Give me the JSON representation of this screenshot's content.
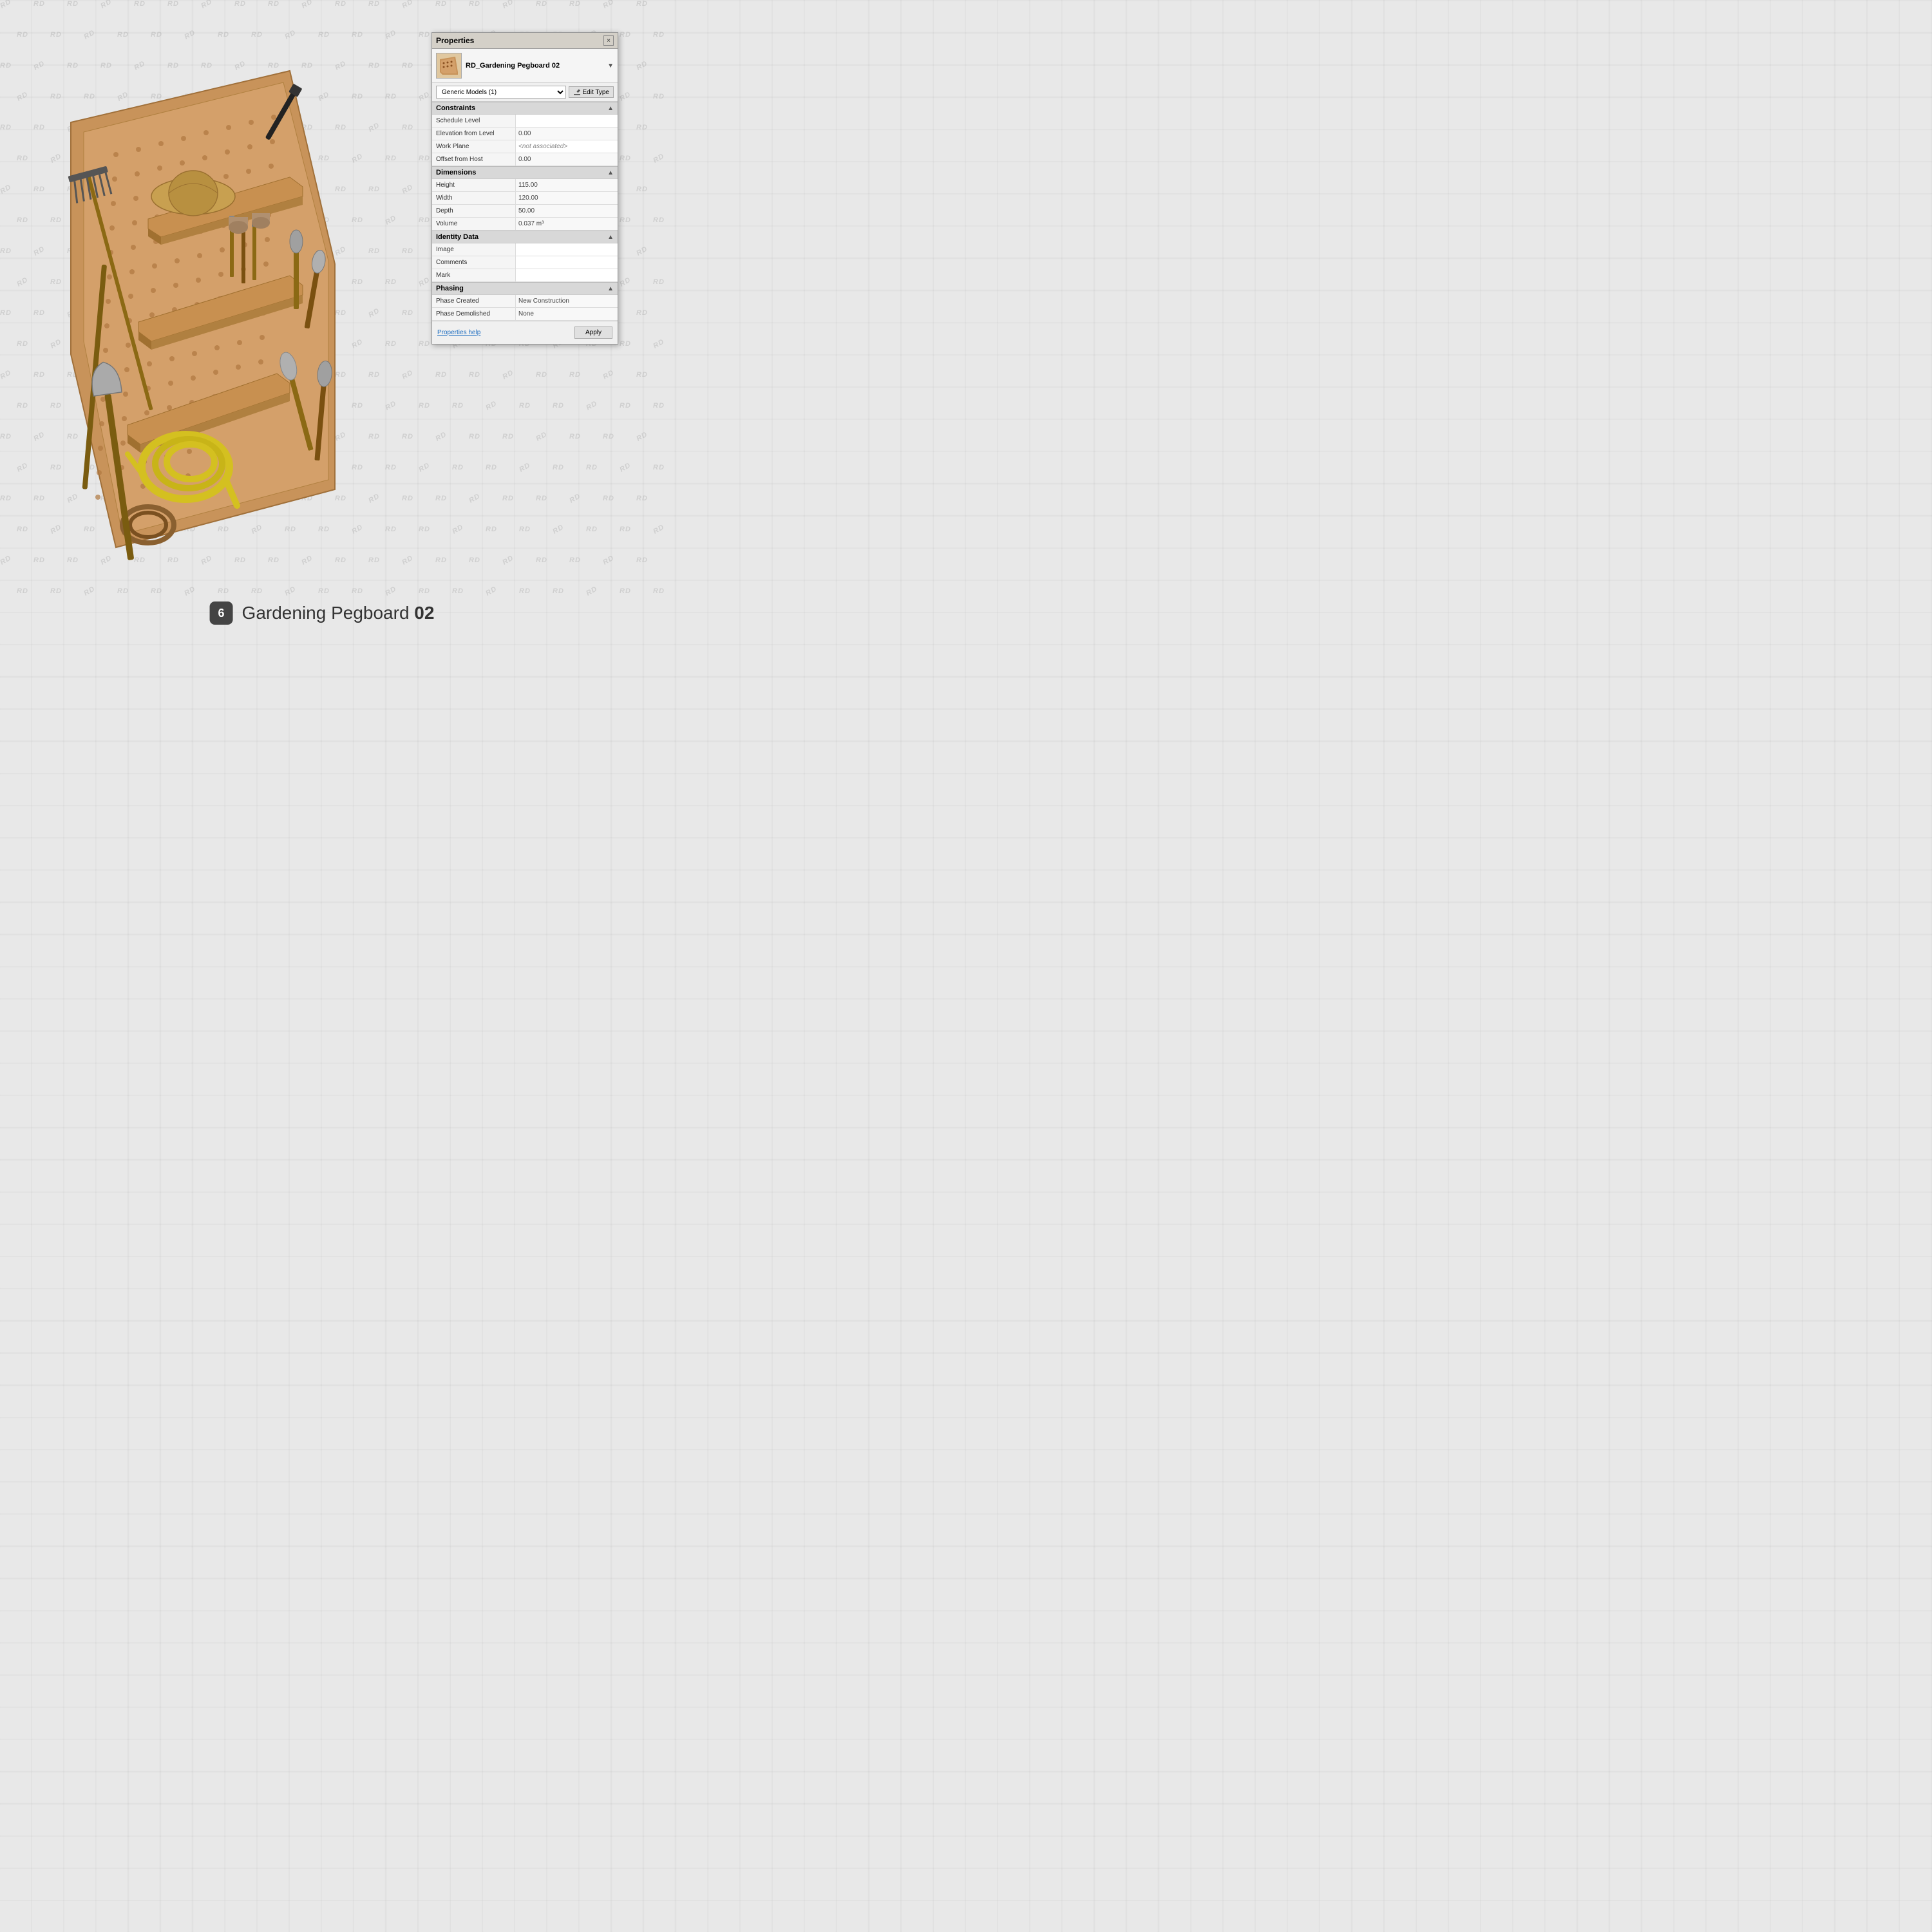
{
  "panel": {
    "title": "Properties",
    "close_label": "×",
    "type_name": "RD_Gardening Pegboard 02",
    "dropdown_value": "Generic Models (1)",
    "edit_type_label": "Edit Type",
    "sections": {
      "constraints": {
        "title": "Constraints",
        "collapse_icon": "▲",
        "rows": [
          {
            "label": "Schedule Level",
            "value": "",
            "type": "editable"
          },
          {
            "label": "Elevation from Level",
            "value": "0.00",
            "type": "readonly"
          },
          {
            "label": "Work Plane",
            "value": "<not associated>",
            "type": "italic-gray"
          },
          {
            "label": "Offset from Host",
            "value": "0.00",
            "type": "readonly"
          }
        ]
      },
      "dimensions": {
        "title": "Dimensions",
        "collapse_icon": "▲",
        "rows": [
          {
            "label": "Height",
            "value": "115.00",
            "type": "readonly"
          },
          {
            "label": "Width",
            "value": "120.00",
            "type": "readonly"
          },
          {
            "label": "Depth",
            "value": "50.00",
            "type": "readonly"
          },
          {
            "label": "Volume",
            "value": "0.037 m³",
            "type": "readonly"
          }
        ]
      },
      "identity_data": {
        "title": "Identity Data",
        "collapse_icon": "▲",
        "rows": [
          {
            "label": "Image",
            "value": "",
            "type": "editable"
          },
          {
            "label": "Comments",
            "value": "",
            "type": "editable"
          },
          {
            "label": "Mark",
            "value": "",
            "type": "editable"
          }
        ]
      },
      "phasing": {
        "title": "Phasing",
        "collapse_icon": "▲",
        "rows": [
          {
            "label": "Phase Created",
            "value": "New Construction",
            "type": "readonly"
          },
          {
            "label": "Phase Demolished",
            "value": "None",
            "type": "readonly"
          }
        ]
      }
    },
    "footer": {
      "help_label": "Properties help",
      "apply_label": "Apply"
    }
  },
  "bottom_title": {
    "number": "6",
    "text_regular": "Gardening Pegboard ",
    "text_bold": "02"
  },
  "watermark": "RD"
}
